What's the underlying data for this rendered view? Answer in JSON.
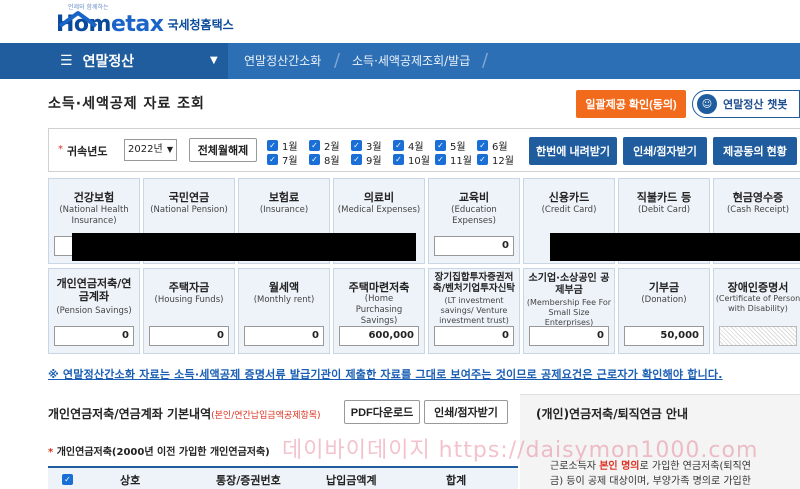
{
  "header": {
    "logo_tagline": "언제와 함께하는",
    "logo_home": "Hom",
    "logo_e": "e",
    "logo_tax": "tax",
    "logo_korean": "국세청홈택스"
  },
  "nav": {
    "menu_label": "연말정산",
    "crumbs": [
      "연말정산간소화",
      "소득·세액공제조회/발급"
    ]
  },
  "page": {
    "title": "소득·세액공제 자료 조회",
    "consent_button": "일괄제공 확인(동의)",
    "chatbot_button": "연말정산 챗봇"
  },
  "filter": {
    "year_label": "귀속년도",
    "year_value": "2022년",
    "toggle_all_button": "전체월해제",
    "months": [
      "1월",
      "2월",
      "3월",
      "4월",
      "5월",
      "6월",
      "7월",
      "8월",
      "9월",
      "10월",
      "11월",
      "12월"
    ],
    "download_all_button": "한번에 내려받기",
    "print_button": "인쇄/점자받기",
    "consent_status_button": "제공동의 현황"
  },
  "deductions_row1": [
    {
      "title": "건강보험",
      "en": "(National Health Insurance)",
      "value": ""
    },
    {
      "title": "국민연금",
      "en": "(National Pension)",
      "value": ""
    },
    {
      "title": "보험료",
      "en": "(Insurance)",
      "value": ""
    },
    {
      "title": "의료비",
      "en": "(Medical Expenses)",
      "value": ""
    },
    {
      "title": "교육비",
      "en": "(Education Expenses)",
      "value": "0"
    },
    {
      "title": "신용카드",
      "en": "(Credit Card)",
      "value": ""
    },
    {
      "title": "직불카드 등",
      "en": "(Debit Card)",
      "value": ""
    },
    {
      "title": "현금영수증",
      "en": "(Cash Receipt)",
      "value": ""
    }
  ],
  "deductions_row2": [
    {
      "title": "개인연금저축/연금계좌",
      "en": "(Pension Savings)",
      "value": "0"
    },
    {
      "title": "주택자금",
      "en": "(Housing Funds)",
      "value": "0"
    },
    {
      "title": "월세액",
      "en": "(Monthly rent)",
      "value": "0"
    },
    {
      "title": "주택마련저축",
      "en": "(Home Purchasing Savings)",
      "value": "600,000"
    },
    {
      "title": "장기집합투자증권저축/벤처기업투자신탁",
      "en": "(LT investment savings/ Venture investment trust)",
      "value": "0"
    },
    {
      "title": "소기업·소상공인 공제부금",
      "en": "(Membership Fee For Small Size Enterprises)",
      "value": "0"
    },
    {
      "title": "기부금",
      "en": "(Donation)",
      "value": "50,000"
    },
    {
      "title": "장애인증명서",
      "en": "(Certificate of Person with Disability)",
      "value": ""
    }
  ],
  "notice": "※ 연말정산간소화 자료는 소득·세액공제 증명서류 발급기관이 제출한 자료를 그대로 보여주는 것이므로 공제요건은 근로자가 확인해야 합니다.",
  "pension_section": {
    "title": "개인연금저축/연금계좌 기본내역",
    "note": "(본인/연간납입금액공제항목)",
    "pdf_button": "PDF다운로드",
    "print_button": "인쇄/점자받기",
    "subtitle": "개인연금저축(2000년 이전 가입한 개인연금저축)",
    "columns": [
      "상호",
      "통장/증권번호",
      "납입금액계",
      "합계"
    ]
  },
  "side_panel": {
    "title": "(개인)연금저축/퇴직연금 안내",
    "line1_a": "근로소득자 ",
    "line1_red": "본인 명의",
    "line1_b": "로 가입한 연금저축(퇴직연",
    "line2": "금) 등이 공제 대상이며, 부양가족 명의로 가입한"
  },
  "watermark": "데이바이데이지 https://daisymon1000.com"
}
